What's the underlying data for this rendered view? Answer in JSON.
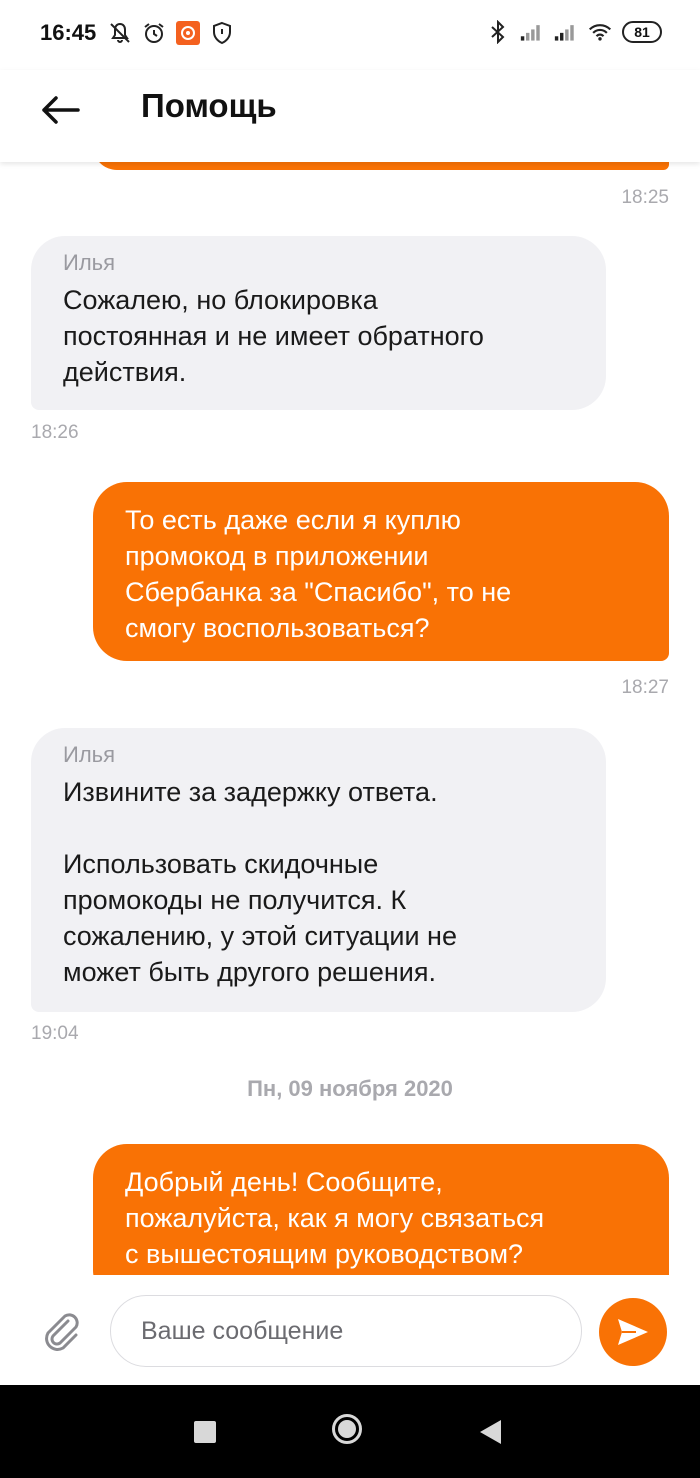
{
  "status_bar": {
    "time": "16:45",
    "battery": "81",
    "icons_left": [
      "mute-bell-icon",
      "alarm-icon",
      "app-notification-icon",
      "shield-icon"
    ],
    "icons_right": [
      "bluetooth-icon",
      "signal-icon",
      "signal-icon",
      "wifi-icon",
      "battery-icon"
    ]
  },
  "header": {
    "title": "Помощь",
    "back_icon": "arrow-left-icon"
  },
  "messages": [
    {
      "direction": "out",
      "text": "",
      "time": "18:25",
      "partial": true
    },
    {
      "direction": "in",
      "sender": "Илья",
      "text": "Сожалею, но блокировка\nпостоянная и не имеет обратного\nдействия.",
      "time": "18:26"
    },
    {
      "direction": "out",
      "text": "То есть даже если я куплю\nпромокод в приложении\nСбербанка за \"Спасибо\", то не\nсмогу воспользоваться?",
      "time": "18:27"
    },
    {
      "direction": "in",
      "sender": "Илья",
      "text": "Извините за задержку ответа.\n\nИспользовать скидочные\nпромокоды не получится. К\nсожалению, у этой ситуации не\nможет быть другого решения.",
      "time": "19:04"
    }
  ],
  "date_separator": "Пн, 09 ноября 2020",
  "last_message": {
    "direction": "out",
    "text": "Добрый день! Сообщите,\nпожалуйста, как я могу связаться\nс вышестоящим руководством?"
  },
  "composer": {
    "placeholder": "Ваше сообщение",
    "value": "",
    "attach_icon": "paperclip-icon",
    "send_icon": "send-arrow-icon"
  },
  "colors": {
    "accent": "#f97205",
    "incoming_bubble": "#f1f1f4",
    "timestamp": "#a9a9ae"
  }
}
